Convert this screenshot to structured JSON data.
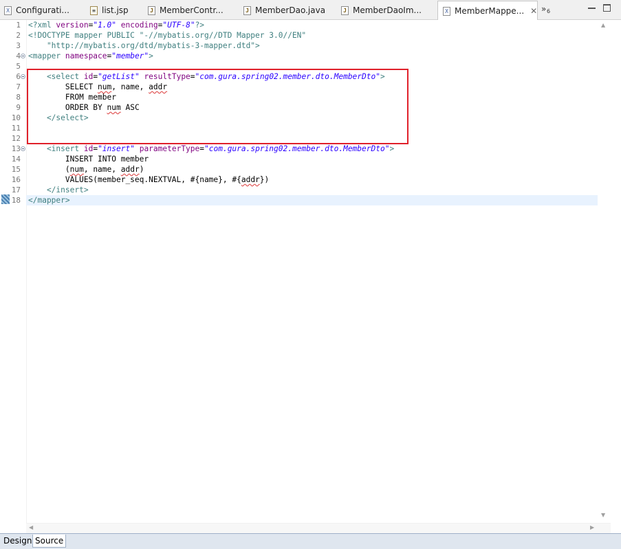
{
  "tabs": [
    {
      "label": "Configurati...",
      "icon": "xml-file-icon",
      "active": false
    },
    {
      "label": "list.jsp",
      "icon": "jsp-file-icon",
      "active": false
    },
    {
      "label": "MemberContr...",
      "icon": "java-file-icon",
      "active": false
    },
    {
      "label": "MemberDao.java",
      "icon": "java-file-icon",
      "active": false
    },
    {
      "label": "MemberDaoIm...",
      "icon": "java-file-icon",
      "active": false
    },
    {
      "label": "MemberMappe...",
      "icon": "xml-file-icon",
      "active": true
    }
  ],
  "tab_overflow": {
    "chevron": "»",
    "count": "6"
  },
  "tab_close": "✕",
  "editor": {
    "line_numbers": [
      "1",
      "2",
      "3",
      "4",
      "5",
      "6",
      "7",
      "8",
      "9",
      "10",
      "11",
      "12",
      "13",
      "14",
      "15",
      "16",
      "17",
      "18"
    ],
    "current_line": "18",
    "lines": [
      {
        "p1": "<?xml ",
        "a1": "version",
        "e1": "=",
        "v1": "\"1.0\"",
        "s1": " ",
        "a2": "encoding",
        "e2": "=",
        "v2": "\"UTF-8\"",
        "p2": "?>"
      },
      {
        "p1": "<!DOCTYPE mapper PUBLIC ",
        "v1": "\"-//mybatis.org//DTD Mapper 3.0//EN\""
      },
      {
        "v1": "    \"http://mybatis.org/dtd/mybatis-3-mapper.dtd\">"
      },
      {
        "p1": "<mapper ",
        "a1": "namespace",
        "e1": "=",
        "v1": "\"member\"",
        "p2": ">"
      },
      {},
      {
        "p1": "    <select ",
        "a1": "id",
        "e1": "=",
        "v1": "\"getList\"",
        "s1": " ",
        "a2": "resultType",
        "e2": "=",
        "v2": "\"com.gura.spring02.member.dto.MemberDto\"",
        "p2": ">"
      },
      {
        "t1": "        SELECT ",
        "q1": "num",
        "t2": ", name, ",
        "q2": "addr"
      },
      {
        "t1": "        FROM member"
      },
      {
        "t1": "        ORDER BY ",
        "q1": "num",
        "t2": " ASC"
      },
      {
        "p1": "    </select>"
      },
      {},
      {},
      {
        "p1": "    <insert ",
        "a1": "id",
        "e1": "=",
        "v1": "\"insert\"",
        "s1": " ",
        "a2": "parameterType",
        "e2": "=",
        "v2": "\"com.gura.spring02.member.dto.MemberDto\"",
        "p2": ">"
      },
      {
        "t1": "        INSERT INTO member"
      },
      {
        "t1": "        (",
        "q1": "num",
        "t2": ", name, ",
        "q2": "addr",
        "t3": ")"
      },
      {
        "t1": "        VALUES(member_seq.NEXTVAL, #{name}, #{",
        "q1": "addr",
        "t2": "})"
      },
      {
        "p1": "    </insert>"
      },
      {
        "p1": "</mapper>"
      }
    ]
  },
  "bottom_tabs": [
    {
      "label": "Design",
      "active": false
    },
    {
      "label": "Source",
      "active": true
    }
  ],
  "colors": {
    "highlight_box": "#e0202a",
    "tag": "#3f7f7f",
    "attribute": "#7f007f",
    "value": "#2a00ff"
  }
}
